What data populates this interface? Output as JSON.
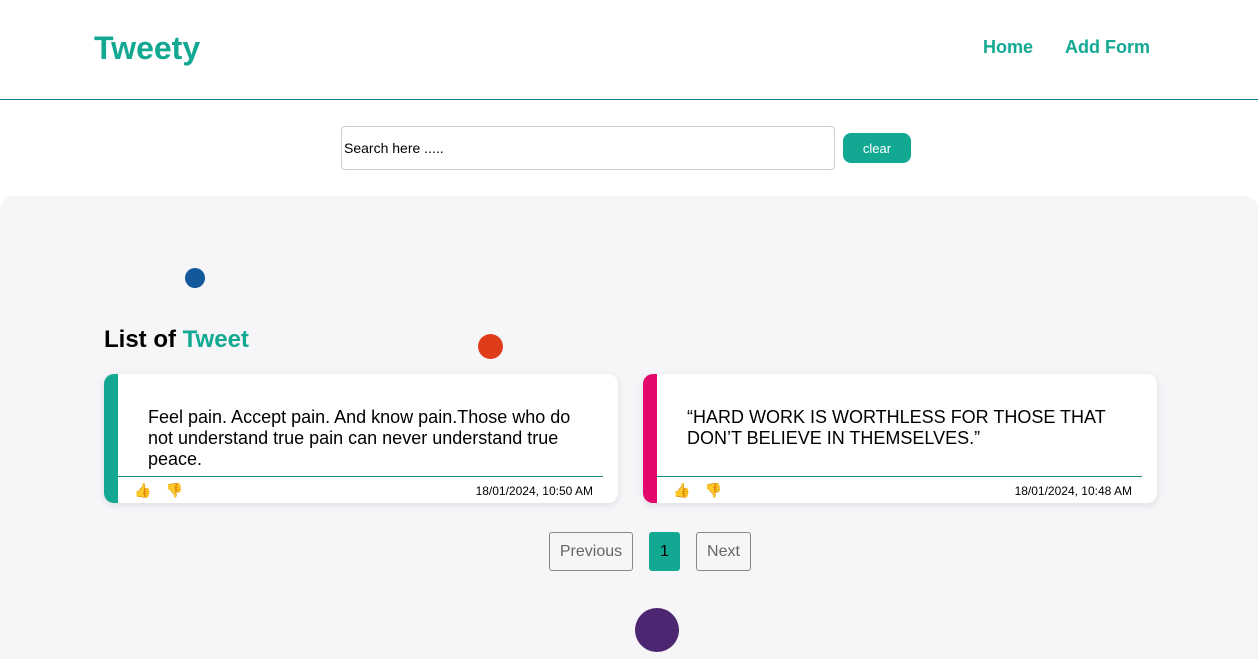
{
  "header": {
    "brand": "Tweety",
    "nav": [
      {
        "label": "Home"
      },
      {
        "label": "Add Form"
      }
    ]
  },
  "search": {
    "placeholder": "Search here .....",
    "value": "",
    "clear_label": "clear"
  },
  "list": {
    "title_prefix": "List of",
    "title_accent": "Tweet"
  },
  "tweets": [
    {
      "text": "Feel pain. Accept pain. And know pain.Those who do not understand true pain can never understand true peace.",
      "like_icon": "👍",
      "dislike_icon": "👎",
      "date": "18/01/2024, 10:50 AM",
      "accent": "#12a892"
    },
    {
      "text": "“HARD WORK IS WORTHLESS FOR THOSE THAT DON’T BELIEVE IN THEMSELVES.”",
      "like_icon": "👍",
      "dislike_icon": "👎",
      "date": "18/01/2024, 10:48 AM",
      "accent": "#e3096a"
    }
  ],
  "pagination": {
    "previous": "Previous",
    "current": "1",
    "next": "Next"
  },
  "colors": {
    "brand": "#12a892",
    "dot_blue": "#12589a",
    "dot_red": "#df3c1c",
    "dot_purple": "#4c2670"
  }
}
